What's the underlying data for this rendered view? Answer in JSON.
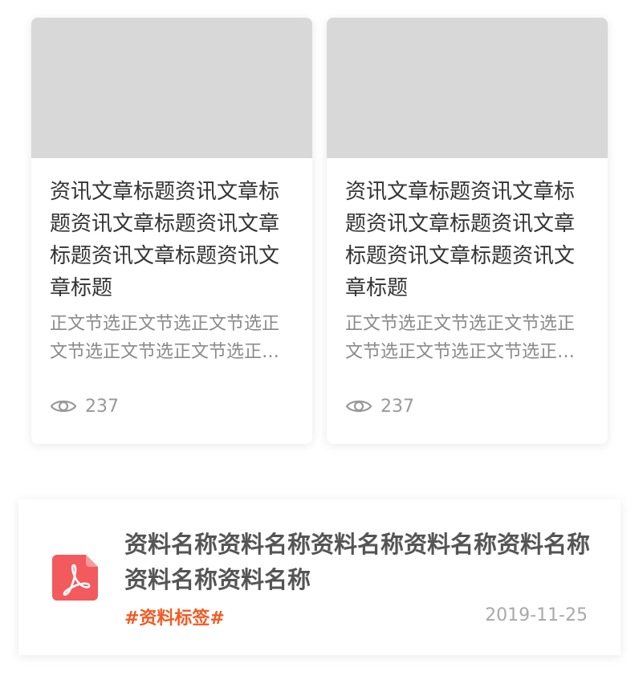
{
  "articles": [
    {
      "title": "资讯文章标题资讯文章标题资讯文章标题资讯文章标题资讯文章标题资讯文章标题",
      "excerpt": "正文节选正文节选正文节选正文节选正文节选正文节选正文节选正文节选",
      "views": "237",
      "icon": "eye-icon"
    },
    {
      "title": "资讯文章标题资讯文章标题资讯文章标题资讯文章标题资讯文章标题资讯文章标题",
      "excerpt": "正文节选正文节选正文节选正文节选正文节选正文节选正文节选正文节选",
      "views": "237",
      "icon": "eye-icon"
    }
  ],
  "document": {
    "icon": "pdf-icon",
    "title": "资料名称资料名称资料名称资料名称资料名称资料名称资料名称",
    "tag": "#资料标签#",
    "date": "2019-11-25"
  },
  "colors": {
    "thumbnail_placeholder": "#d8d8d8",
    "tag": "#f35a22",
    "pdf_icon": "#f25a5d"
  }
}
